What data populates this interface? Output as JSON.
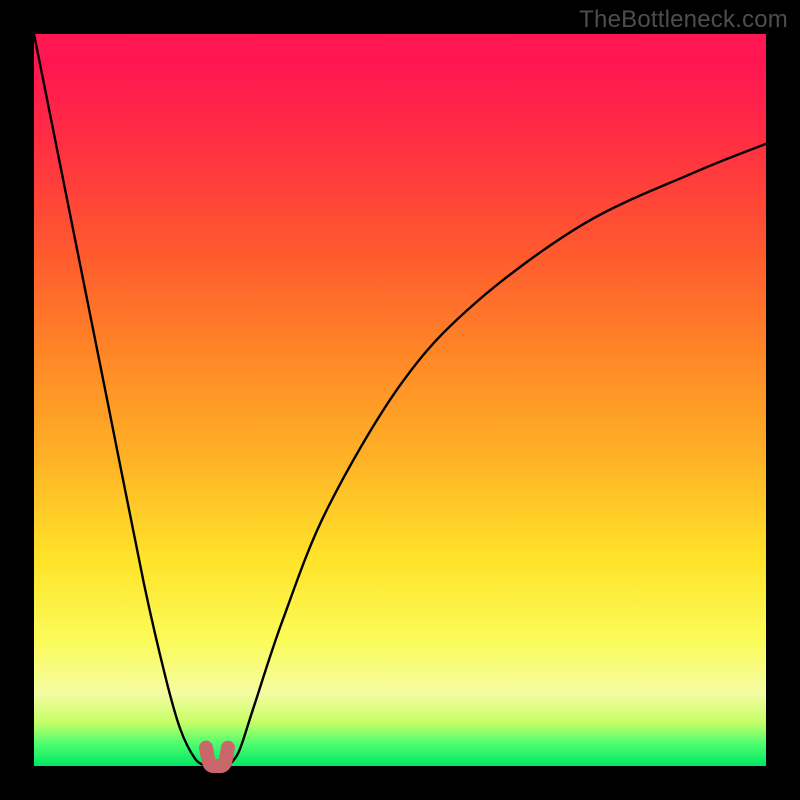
{
  "watermark": "TheBottleneck.com",
  "colors": {
    "frame": "#000000",
    "marker": "#c9676b",
    "curve": "#000000"
  },
  "chart_data": {
    "type": "line",
    "title": "",
    "xlabel": "",
    "ylabel": "",
    "xlim": [
      0,
      100
    ],
    "ylim": [
      0,
      100
    ],
    "series": [
      {
        "name": "left-branch",
        "x": [
          0,
          5,
          10,
          15,
          18,
          20,
          22,
          23.5
        ],
        "y": [
          100,
          75,
          50,
          25,
          12,
          5,
          1,
          0
        ]
      },
      {
        "name": "right-branch",
        "x": [
          26.5,
          28,
          30,
          34,
          40,
          50,
          60,
          75,
          90,
          100
        ],
        "y": [
          0,
          2,
          8,
          20,
          35,
          52,
          63,
          74,
          81,
          85
        ]
      },
      {
        "name": "valley-marker",
        "x": [
          23.5,
          24,
          25,
          26,
          26.5
        ],
        "y": [
          2.5,
          0.3,
          0,
          0.3,
          2.5
        ]
      }
    ],
    "annotations": [],
    "legend": false,
    "grid": false
  }
}
